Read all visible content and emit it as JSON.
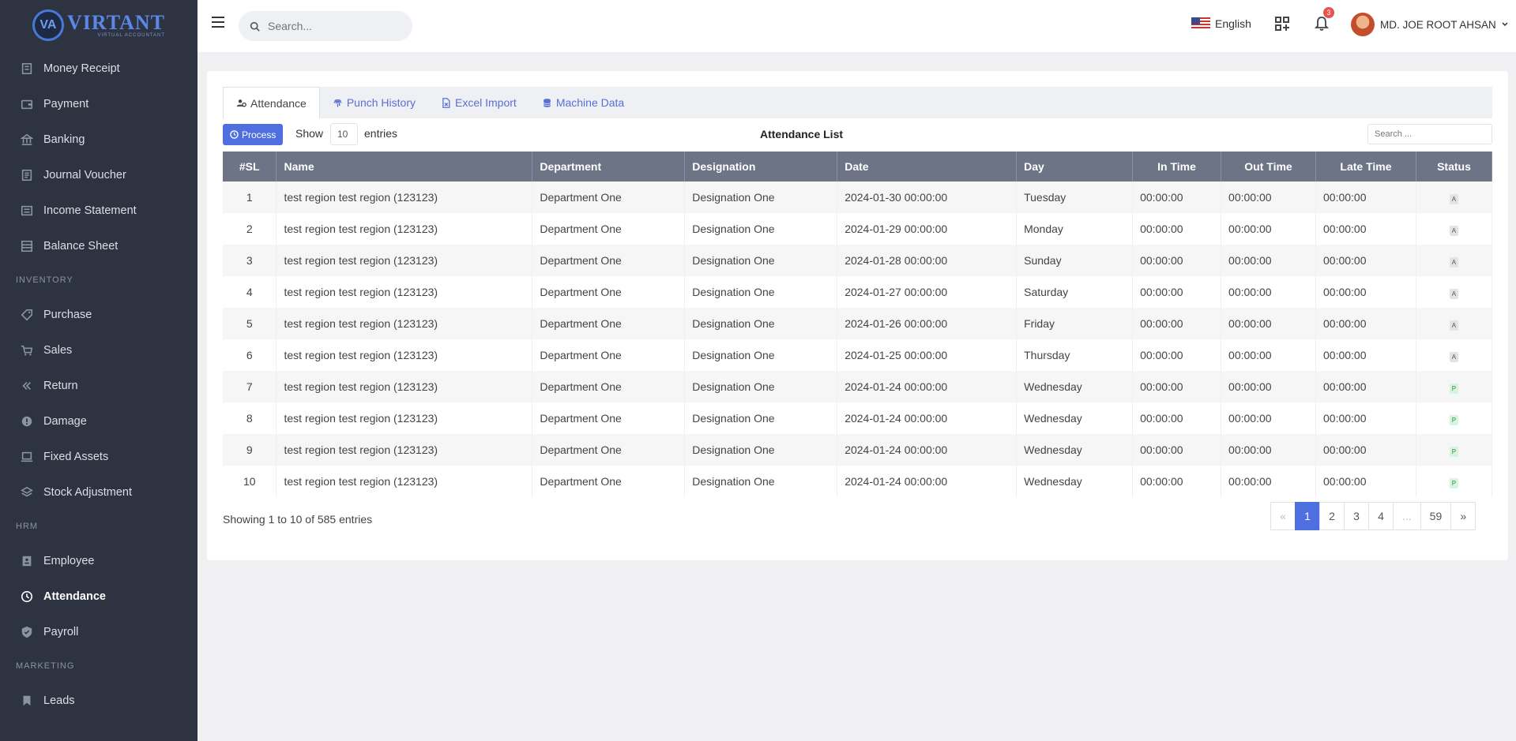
{
  "brand": {
    "name": "VIRTANT",
    "sub": "VIRTUAL ACCOUNTANT",
    "mark": "VA"
  },
  "sidebar": {
    "items": [
      {
        "label": "Money Receipt",
        "icon": "receipt-icon",
        "type": "item"
      },
      {
        "label": "Payment",
        "icon": "wallet-icon",
        "type": "item"
      },
      {
        "label": "Banking",
        "icon": "bank-icon",
        "type": "item"
      },
      {
        "label": "Journal Voucher",
        "icon": "journal-icon",
        "type": "item"
      },
      {
        "label": "Income Statement",
        "icon": "statement-icon",
        "type": "item"
      },
      {
        "label": "Balance Sheet",
        "icon": "sheet-icon",
        "type": "item"
      },
      {
        "label": "INVENTORY",
        "type": "section"
      },
      {
        "label": "Purchase",
        "icon": "tag-icon",
        "type": "item"
      },
      {
        "label": "Sales",
        "icon": "cart-icon",
        "type": "item"
      },
      {
        "label": "Return",
        "icon": "chevrons-left-icon",
        "type": "item"
      },
      {
        "label": "Damage",
        "icon": "alert-circle-icon",
        "type": "item"
      },
      {
        "label": "Fixed Assets",
        "icon": "laptop-icon",
        "type": "item"
      },
      {
        "label": "Stock Adjustment",
        "icon": "layers-icon",
        "type": "item"
      },
      {
        "label": "HRM",
        "type": "section"
      },
      {
        "label": "Employee",
        "icon": "id-card-icon",
        "type": "item"
      },
      {
        "label": "Attendance",
        "icon": "clock-icon",
        "type": "item",
        "active": true
      },
      {
        "label": "Payroll",
        "icon": "shield-icon",
        "type": "item"
      },
      {
        "label": "MARKETING",
        "type": "section"
      },
      {
        "label": "Leads",
        "icon": "bookmark-icon",
        "type": "item"
      }
    ]
  },
  "topbar": {
    "search_placeholder": "Search...",
    "language": "English",
    "notification_count": "3",
    "user_name": "MD. JOE ROOT AHSAN"
  },
  "tabs": [
    {
      "label": "Attendance",
      "active": true
    },
    {
      "label": "Punch History",
      "active": false
    },
    {
      "label": "Excel Import",
      "active": false
    },
    {
      "label": "Machine Data",
      "active": false
    }
  ],
  "controls": {
    "process_label": "Process",
    "show_label": "Show",
    "page_size": "10",
    "entries_label": "entries",
    "list_title": "Attendance List",
    "table_search_placeholder": "Search ..."
  },
  "table": {
    "headers": [
      "#SL",
      "Name",
      "Department",
      "Designation",
      "Date",
      "Day",
      "In Time",
      "Out Time",
      "Late Time",
      "Status"
    ],
    "rows": [
      [
        "1",
        "test region test region (123123)",
        "Department One",
        "Designation One",
        "2024-01-30 00:00:00",
        "Tuesday",
        "00:00:00",
        "00:00:00",
        "00:00:00",
        "A"
      ],
      [
        "2",
        "test region test region (123123)",
        "Department One",
        "Designation One",
        "2024-01-29 00:00:00",
        "Monday",
        "00:00:00",
        "00:00:00",
        "00:00:00",
        "A"
      ],
      [
        "3",
        "test region test region (123123)",
        "Department One",
        "Designation One",
        "2024-01-28 00:00:00",
        "Sunday",
        "00:00:00",
        "00:00:00",
        "00:00:00",
        "A"
      ],
      [
        "4",
        "test region test region (123123)",
        "Department One",
        "Designation One",
        "2024-01-27 00:00:00",
        "Saturday",
        "00:00:00",
        "00:00:00",
        "00:00:00",
        "A"
      ],
      [
        "5",
        "test region test region (123123)",
        "Department One",
        "Designation One",
        "2024-01-26 00:00:00",
        "Friday",
        "00:00:00",
        "00:00:00",
        "00:00:00",
        "A"
      ],
      [
        "6",
        "test region test region (123123)",
        "Department One",
        "Designation One",
        "2024-01-25 00:00:00",
        "Thursday",
        "00:00:00",
        "00:00:00",
        "00:00:00",
        "A"
      ],
      [
        "7",
        "test region test region (123123)",
        "Department One",
        "Designation One",
        "2024-01-24 00:00:00",
        "Wednesday",
        "00:00:00",
        "00:00:00",
        "00:00:00",
        "P"
      ],
      [
        "8",
        "test region test region (123123)",
        "Department One",
        "Designation One",
        "2024-01-24 00:00:00",
        "Wednesday",
        "00:00:00",
        "00:00:00",
        "00:00:00",
        "P"
      ],
      [
        "9",
        "test region test region (123123)",
        "Department One",
        "Designation One",
        "2024-01-24 00:00:00",
        "Wednesday",
        "00:00:00",
        "00:00:00",
        "00:00:00",
        "P"
      ],
      [
        "10",
        "test region test region (123123)",
        "Department One",
        "Designation One",
        "2024-01-24 00:00:00",
        "Wednesday",
        "00:00:00",
        "00:00:00",
        "00:00:00",
        "P"
      ]
    ]
  },
  "footer": {
    "info": "Showing 1 to 10 of 585 entries",
    "pages": [
      {
        "label": "«",
        "state": "disabled"
      },
      {
        "label": "1",
        "state": "active"
      },
      {
        "label": "2",
        "state": ""
      },
      {
        "label": "3",
        "state": ""
      },
      {
        "label": "4",
        "state": ""
      },
      {
        "label": "...",
        "state": "disabled"
      },
      {
        "label": "59",
        "state": ""
      },
      {
        "label": "»",
        "state": ""
      }
    ]
  },
  "colors": {
    "sidebar_bg": "#2d3340",
    "accent": "#4f6fe0",
    "table_header": "#6c7486"
  }
}
